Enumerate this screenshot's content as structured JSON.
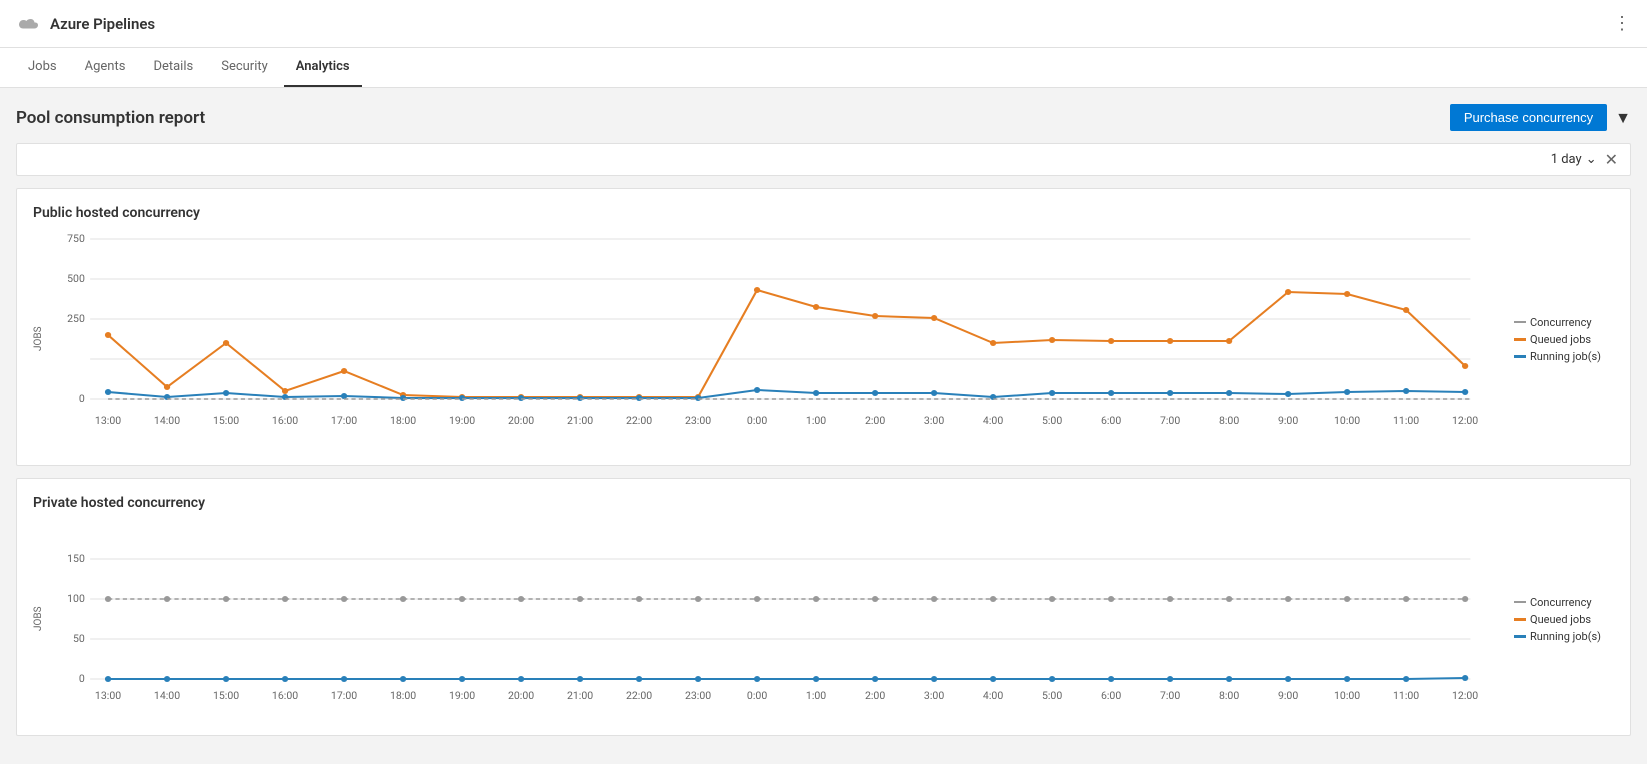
{
  "app": {
    "title": "Azure Pipelines"
  },
  "nav": {
    "tabs": [
      {
        "id": "jobs",
        "label": "Jobs"
      },
      {
        "id": "agents",
        "label": "Agents"
      },
      {
        "id": "details",
        "label": "Details"
      },
      {
        "id": "security",
        "label": "Security"
      },
      {
        "id": "analytics",
        "label": "Analytics",
        "active": true
      }
    ]
  },
  "page": {
    "title": "Pool consumption report",
    "purchase_btn": "Purchase concurrency",
    "filter_day": "1 day"
  },
  "legend": {
    "concurrency": "Concurrency",
    "queued": "Queued jobs",
    "running": "Running job(s)"
  },
  "public_chart": {
    "title": "Public hosted concurrency",
    "y_label": "JOBS",
    "y_ticks": [
      "750",
      "500",
      "250",
      "0"
    ],
    "x_ticks": [
      "13:00",
      "14:00",
      "15:00",
      "16:00",
      "17:00",
      "18:00",
      "19:00",
      "20:00",
      "21:00",
      "22:00",
      "23:00",
      "0:00",
      "1:00",
      "2:00",
      "3:00",
      "4:00",
      "5:00",
      "6:00",
      "7:00",
      "8:00",
      "9:00",
      "10:00",
      "11:00",
      "12:00"
    ]
  },
  "private_chart": {
    "title": "Private hosted concurrency",
    "y_label": "JOBS",
    "y_ticks": [
      "150",
      "100",
      "50",
      "0"
    ],
    "x_ticks": [
      "13:00",
      "14:00",
      "15:00",
      "16:00",
      "17:00",
      "18:00",
      "19:00",
      "20:00",
      "21:00",
      "22:00",
      "23:00",
      "0:00",
      "1:00",
      "2:00",
      "3:00",
      "4:00",
      "5:00",
      "6:00",
      "7:00",
      "8:00",
      "9:00",
      "10:00",
      "11:00",
      "12:00"
    ]
  }
}
